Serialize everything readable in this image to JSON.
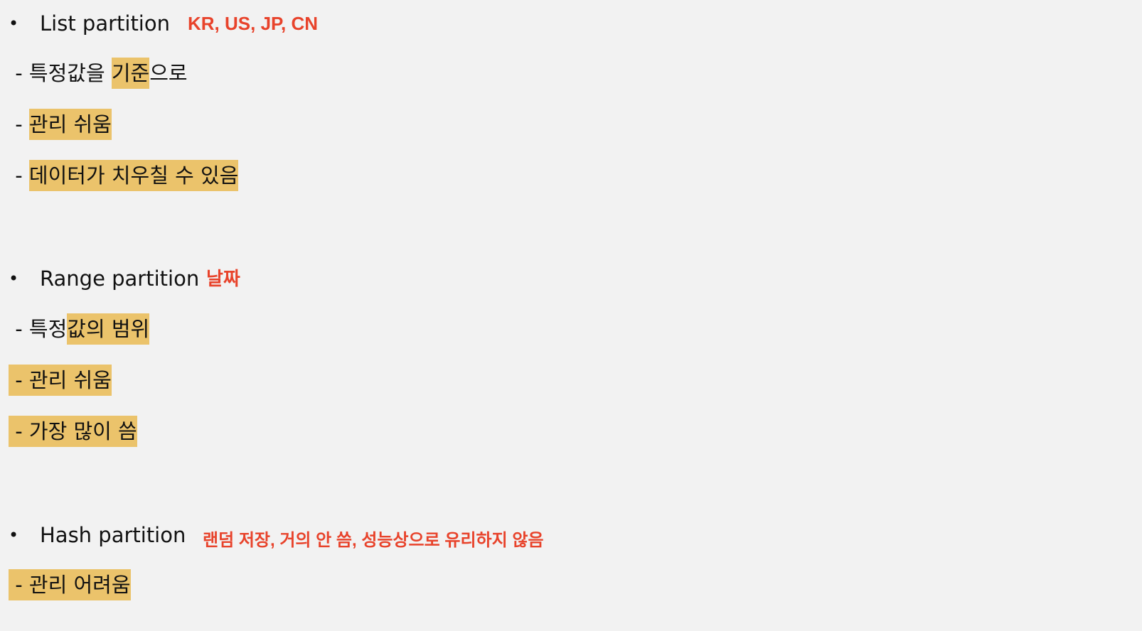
{
  "colors": {
    "background": "#f2f2f2",
    "highlight": "#ebc36b",
    "note_red": "#e8432b",
    "text": "#111111"
  },
  "sections": [
    {
      "bullet": "•",
      "title": "List partition",
      "note": "KR, US, JP, CN",
      "lines": [
        {
          "prefix": " - 특정값을 ",
          "highlight": "기준",
          "suffix": "으로"
        },
        {
          "prefix": " - ",
          "highlight": "관리 쉬움",
          "suffix": ""
        },
        {
          "prefix": " - ",
          "highlight": "데이터가 치우칠 수 있음",
          "suffix": ""
        }
      ]
    },
    {
      "bullet": "•",
      "title": "Range partition",
      "note": "날짜",
      "lines": [
        {
          "prefix": " - 특정",
          "highlight": "값의 범위",
          "suffix": ""
        },
        {
          "prefix": "",
          "highlight": " - 관리 쉬움",
          "suffix": ""
        },
        {
          "prefix": "",
          "highlight": " - 가장 많이 씀",
          "suffix": ""
        }
      ]
    },
    {
      "bullet": "•",
      "title": "Hash partition",
      "note": "랜덤 저장, 거의 안 씀, 성능상으로 유리하지 않음",
      "lines": [
        {
          "prefix": "",
          "highlight": " - 관리 어려움",
          "suffix": ""
        }
      ]
    }
  ]
}
